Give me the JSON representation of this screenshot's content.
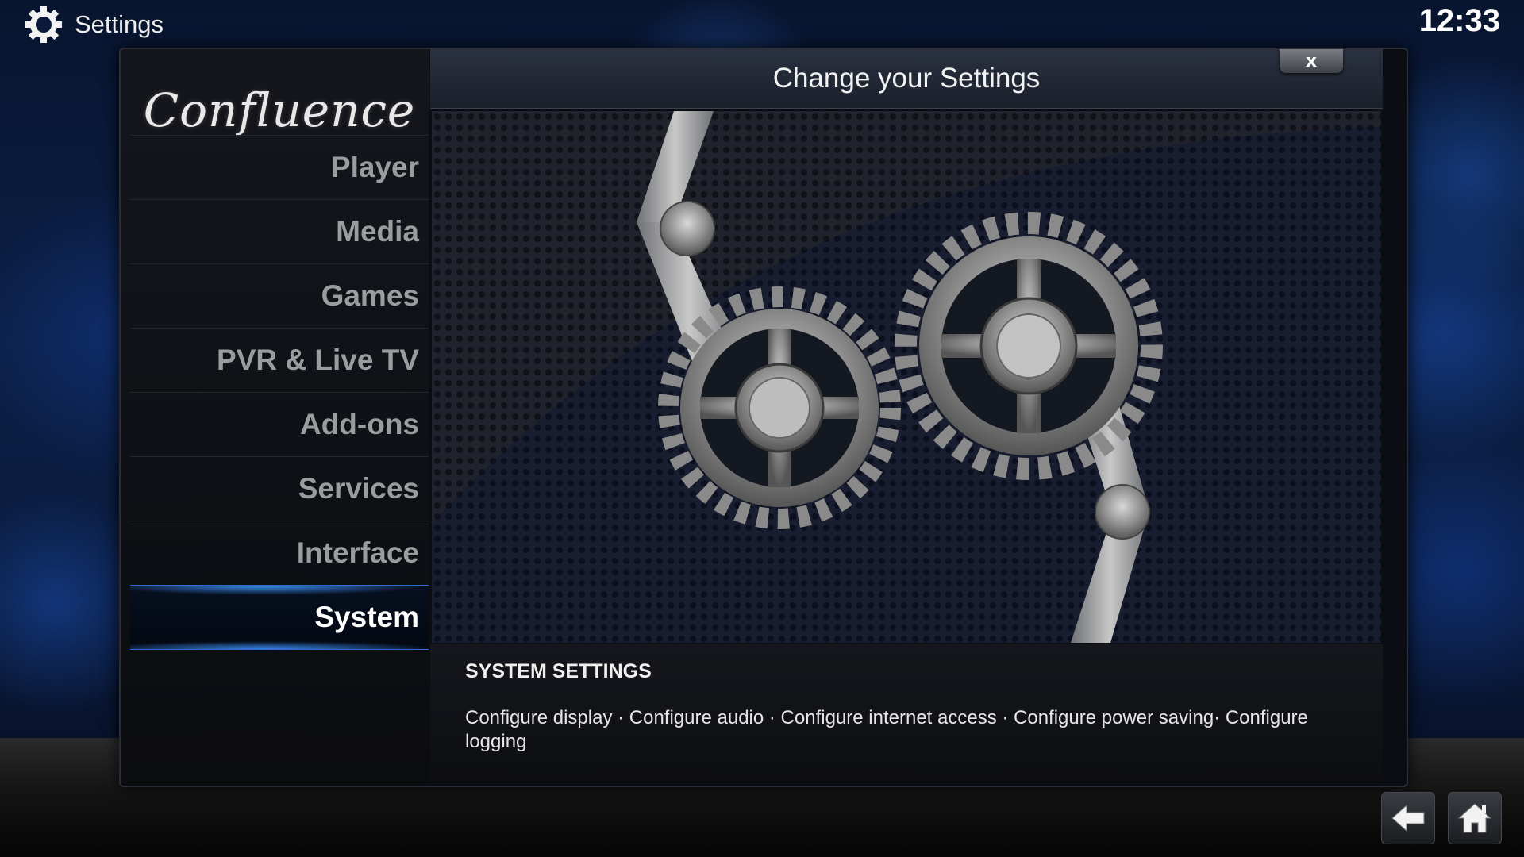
{
  "header": {
    "title": "Settings",
    "clock": "12:33",
    "icon": "gear-icon"
  },
  "sidebar": {
    "logo": "Confluence",
    "items": [
      {
        "label": "Player",
        "selected": false
      },
      {
        "label": "Media",
        "selected": false
      },
      {
        "label": "Games",
        "selected": false
      },
      {
        "label": "PVR & Live TV",
        "selected": false
      },
      {
        "label": "Add-ons",
        "selected": false
      },
      {
        "label": "Services",
        "selected": false
      },
      {
        "label": "Interface",
        "selected": false
      },
      {
        "label": "System",
        "selected": true
      }
    ]
  },
  "dialog": {
    "title": "Change your Settings",
    "close_label": "x"
  },
  "description": {
    "heading": "SYSTEM SETTINGS",
    "body": "Configure display · Configure audio · Configure internet access · Configure power saving· Configure logging"
  },
  "footer": {
    "back_icon": "back-arrow-icon",
    "home_icon": "home-icon"
  },
  "colors": {
    "accent": "#2b6bd0",
    "background": "#0b1f45"
  }
}
